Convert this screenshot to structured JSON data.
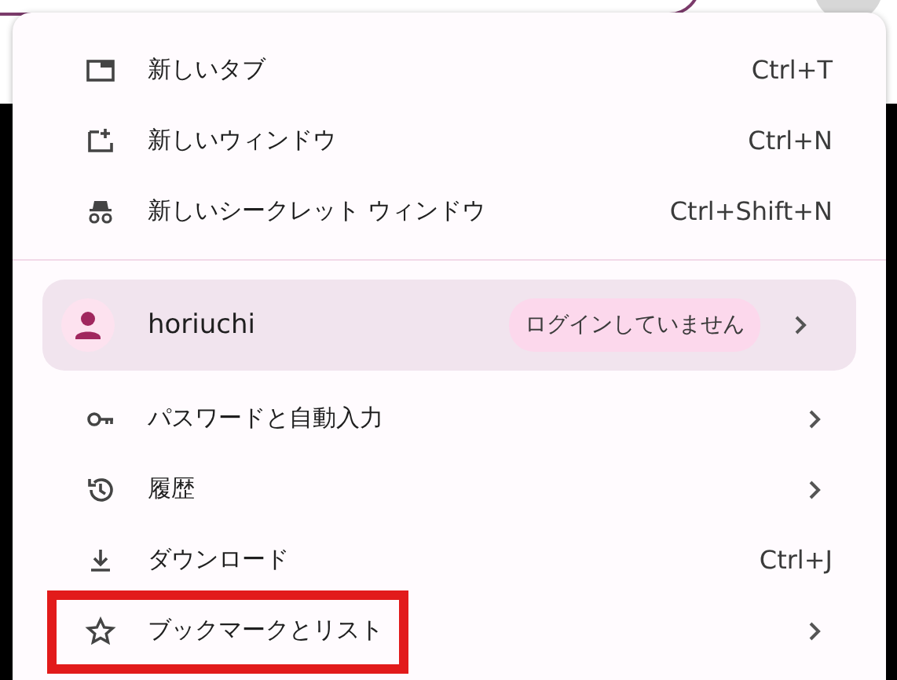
{
  "menu": {
    "groups": [
      {
        "items": [
          {
            "label": "新しいタブ",
            "shortcut": "Ctrl+T",
            "submenu": false,
            "highlighted": false
          },
          {
            "label": "新しいウィンドウ",
            "shortcut": "Ctrl+N",
            "submenu": false,
            "highlighted": false
          },
          {
            "label": "新しいシークレット ウィンドウ",
            "shortcut": "Ctrl+Shift+N",
            "submenu": false,
            "highlighted": false
          }
        ]
      },
      {
        "items": [
          {
            "label": "パスワードと自動入力",
            "submenu": true,
            "highlighted": false
          },
          {
            "label": "履歴",
            "submenu": true,
            "highlighted": false
          },
          {
            "label": "ダウンロード",
            "shortcut": "Ctrl+J",
            "submenu": false,
            "highlighted": false
          },
          {
            "label": "ブックマークとリスト",
            "submenu": true,
            "highlighted": true
          }
        ]
      }
    ],
    "profile": {
      "name": "horiuchi",
      "status": "ログインしていません"
    }
  }
}
